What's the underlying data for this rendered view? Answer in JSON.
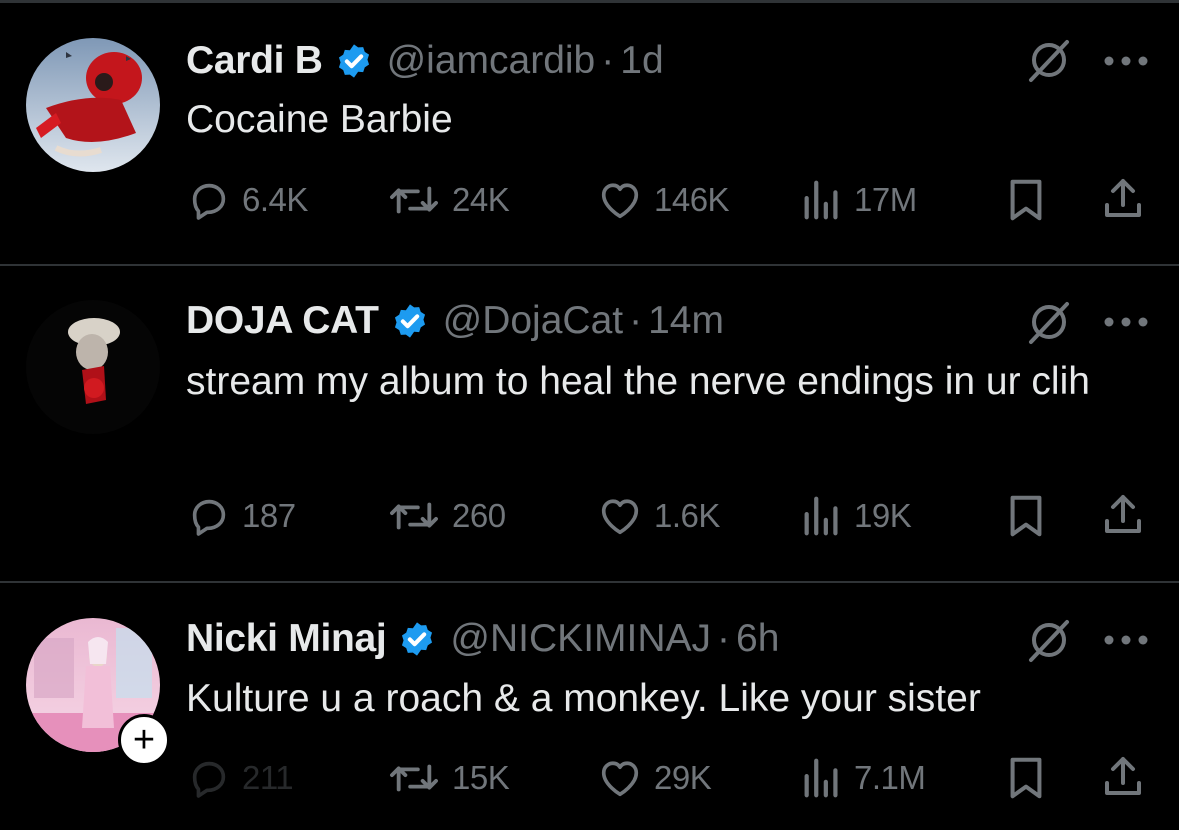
{
  "tweets": [
    {
      "name": "Cardi B",
      "handle": "@iamcardib",
      "separator": "·",
      "time": "1d",
      "text": "Cocaine Barbie",
      "replies": "6.4K",
      "reposts": "24K",
      "likes": "146K",
      "views": "17M"
    },
    {
      "name": "DOJA CAT",
      "handle": "@DojaCat",
      "separator": "·",
      "time": "14m",
      "text": "stream my album to heal the nerve endings in ur clih",
      "replies": "187",
      "reposts": "260",
      "likes": "1.6K",
      "views": "19K"
    },
    {
      "name": "Nicki Minaj",
      "handle": "@NICKIMINAJ",
      "separator": "·",
      "time": "6h",
      "text": "Kulture u a roach & a monkey. Like your sister",
      "replies": "211",
      "reposts": "15K",
      "likes": "29K",
      "views": "7.1M",
      "follow_symbol": "+"
    }
  ],
  "colors": {
    "background": "#000000",
    "text_primary": "#e7e9ea",
    "text_secondary": "#71767b",
    "verified_badge": "#1d9bf0",
    "divider": "#2f3336"
  },
  "icons": [
    "verified-badge-icon",
    "grok-icon",
    "more-icon",
    "reply-icon",
    "repost-icon",
    "like-icon",
    "views-icon",
    "bookmark-icon",
    "share-icon"
  ]
}
